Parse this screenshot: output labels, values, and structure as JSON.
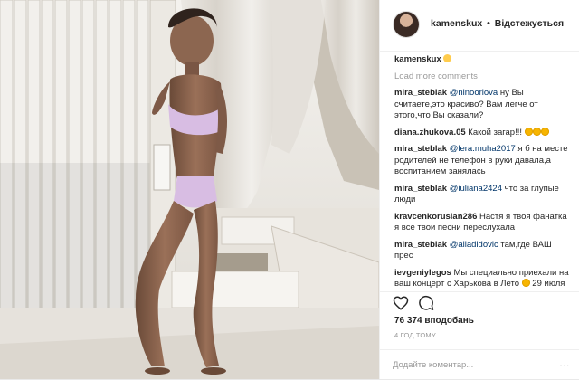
{
  "header": {
    "username": "kamenskux",
    "separator": "•",
    "follow_label": "Відстежується"
  },
  "caption": {
    "username": "kamenskux",
    "emoji": "grin-emoji"
  },
  "load_more_label": "Load more comments",
  "comments": [
    {
      "user": "mira_steblak",
      "mention": "@ninoorlova",
      "text": " ну Вы считаете,это красиво? Вам легче от этого,что Вы сказали?"
    },
    {
      "user": "diana.zhukova.05",
      "text": " Какой загар!!!",
      "emojis": [
        "heart-eyes-emoji",
        "heart-eyes-emoji",
        "heart-eyes-emoji"
      ]
    },
    {
      "user": "mira_steblak",
      "mention": "@lera.muha2017",
      "text": " я б на месте родителей не телефон в руки давала,а воспитанием занялась"
    },
    {
      "user": "mira_steblak",
      "mention": "@iuliana2424",
      "text": " что за глупые люди"
    },
    {
      "user": "kravcenkoruslan286",
      "text": " Настя я твоя фанатка я все твои песни переслухала"
    },
    {
      "user": "mira_steblak",
      "mention": "@alladidovic",
      "text": " там,где ВАШ прес"
    },
    {
      "user": "ievgeniylegos",
      "text": " Мы специально приехали на ваш концерт с Харькова в Лето",
      "emojis": [
        "sunflower-emoji"
      ],
      "tail": " 29 июля"
    }
  ],
  "likes": "76 374 вподобань",
  "time": "4 ГОД ТОМУ",
  "add_comment": {
    "placeholder": "Додайте коментар...",
    "more": "..."
  },
  "icons": {
    "like": "heart-icon",
    "comment": "comment-icon",
    "avatar": "avatar"
  },
  "colors": {
    "mention": "#003569",
    "muted": "#999999",
    "text": "#262626",
    "divider": "#efefef"
  }
}
